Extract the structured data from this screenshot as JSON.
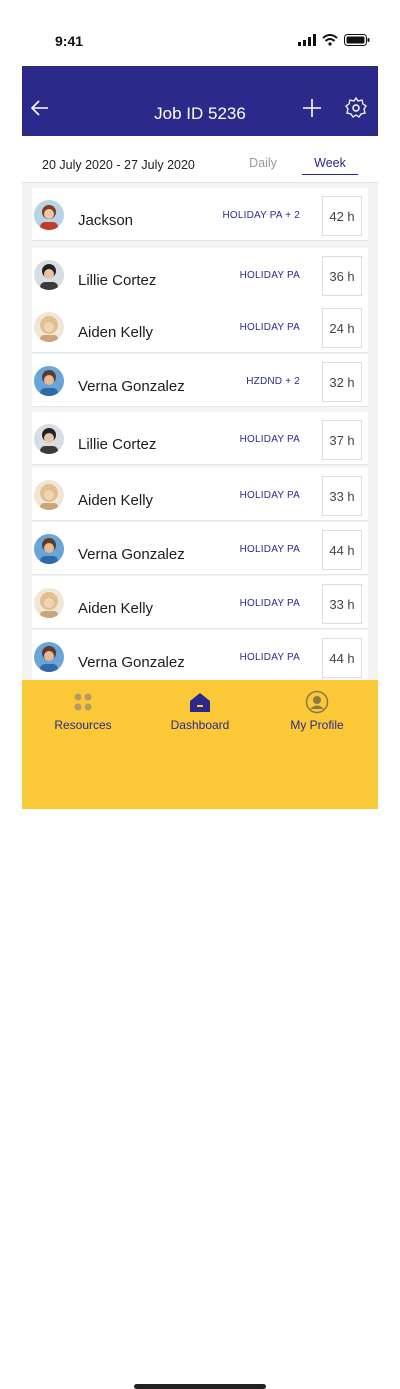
{
  "status": {
    "time": "9:41"
  },
  "header": {
    "title": "Job ID  5236"
  },
  "filters": {
    "date_range": "20 July 2020 - 27 July 2020",
    "tabs": [
      "Daily",
      "Week"
    ]
  },
  "rows": [
    {
      "name": "Jackson",
      "tag": "HOLIDAY PA + 2",
      "hours": "42 h"
    },
    {
      "name": "Lillie Cortez",
      "tag": "HOLIDAY PA",
      "hours": "36 h"
    },
    {
      "name": "Aiden Kelly",
      "tag": "HOLIDAY PA",
      "hours": "24 h"
    },
    {
      "name": "Verna Gonzalez",
      "tag": "HZDND + 2",
      "hours": "32 h"
    },
    {
      "name": "Lillie Cortez",
      "tag": "HOLIDAY PA",
      "hours": "37 h"
    },
    {
      "name": "Aiden Kelly",
      "tag": "HOLIDAY PA",
      "hours": "33 h"
    },
    {
      "name": "Verna Gonzalez",
      "tag": "HOLIDAY PA",
      "hours": "44 h"
    },
    {
      "name": "Aiden Kelly",
      "tag": "HOLIDAY PA",
      "hours": "33 h"
    },
    {
      "name": "Verna Gonzalez",
      "tag": "HOLIDAY PA",
      "hours": "44 h"
    }
  ],
  "nav": {
    "items": [
      "Resources",
      "Dashboard",
      "My Profile"
    ]
  },
  "colors": {
    "primary": "#2b2a8a",
    "accent": "#fbc937"
  }
}
